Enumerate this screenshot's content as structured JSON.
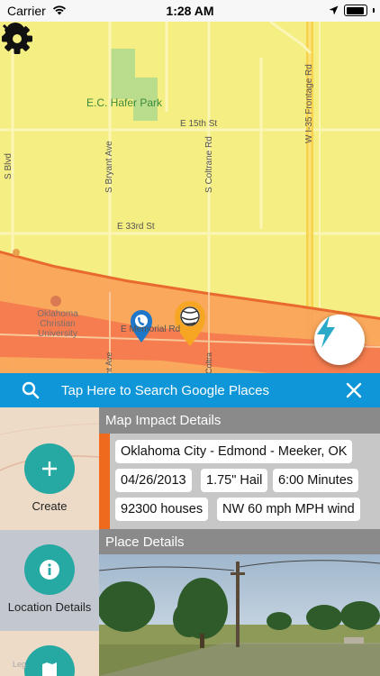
{
  "status_bar": {
    "carrier": "Carrier",
    "time": "1:28 AM"
  },
  "map": {
    "park_name": "E.C. Hafer Park",
    "streets": {
      "e_15th": "E 15th St",
      "e_33rd": "E 33rd St",
      "e_memorial": "E Memorial Rd",
      "s_bryant": "S Bryant Ave",
      "s_coltrane": "S Coltrane Rd",
      "s_blvd": "S Blvd",
      "frontage": "W I-35 Frontage Rd",
      "bryant_ave_short": "Bryant Ave",
      "coltrane_short": "N Coltra"
    },
    "university": "Oklahoma Christian University",
    "legal": "Leg",
    "colors": {
      "base": "#f5ee82",
      "impact_orange": "#f9a35a",
      "impact_red": "#f47a4e",
      "park_green": "#b9dc8d",
      "search_bar": "#0e96d9",
      "accent_teal": "#26a8a3"
    }
  },
  "search": {
    "placeholder": "Tap Here to Search Google Places"
  },
  "sidebar": {
    "items": [
      {
        "label": "Create",
        "icon": "plus-icon"
      },
      {
        "label": "Location Details",
        "icon": "info-icon"
      },
      {
        "label": "",
        "icon": "map-icon"
      }
    ]
  },
  "map_impact": {
    "header": "Map Impact Details",
    "location": "Oklahoma City - Edmond - Meeker, OK",
    "date": "04/26/2013",
    "hail_size": "1.75\" Hail",
    "duration": "6:00 Minutes",
    "houses": "92300 houses",
    "wind": "NW 60 mph MPH wind"
  },
  "place_details": {
    "header": "Place Details"
  }
}
